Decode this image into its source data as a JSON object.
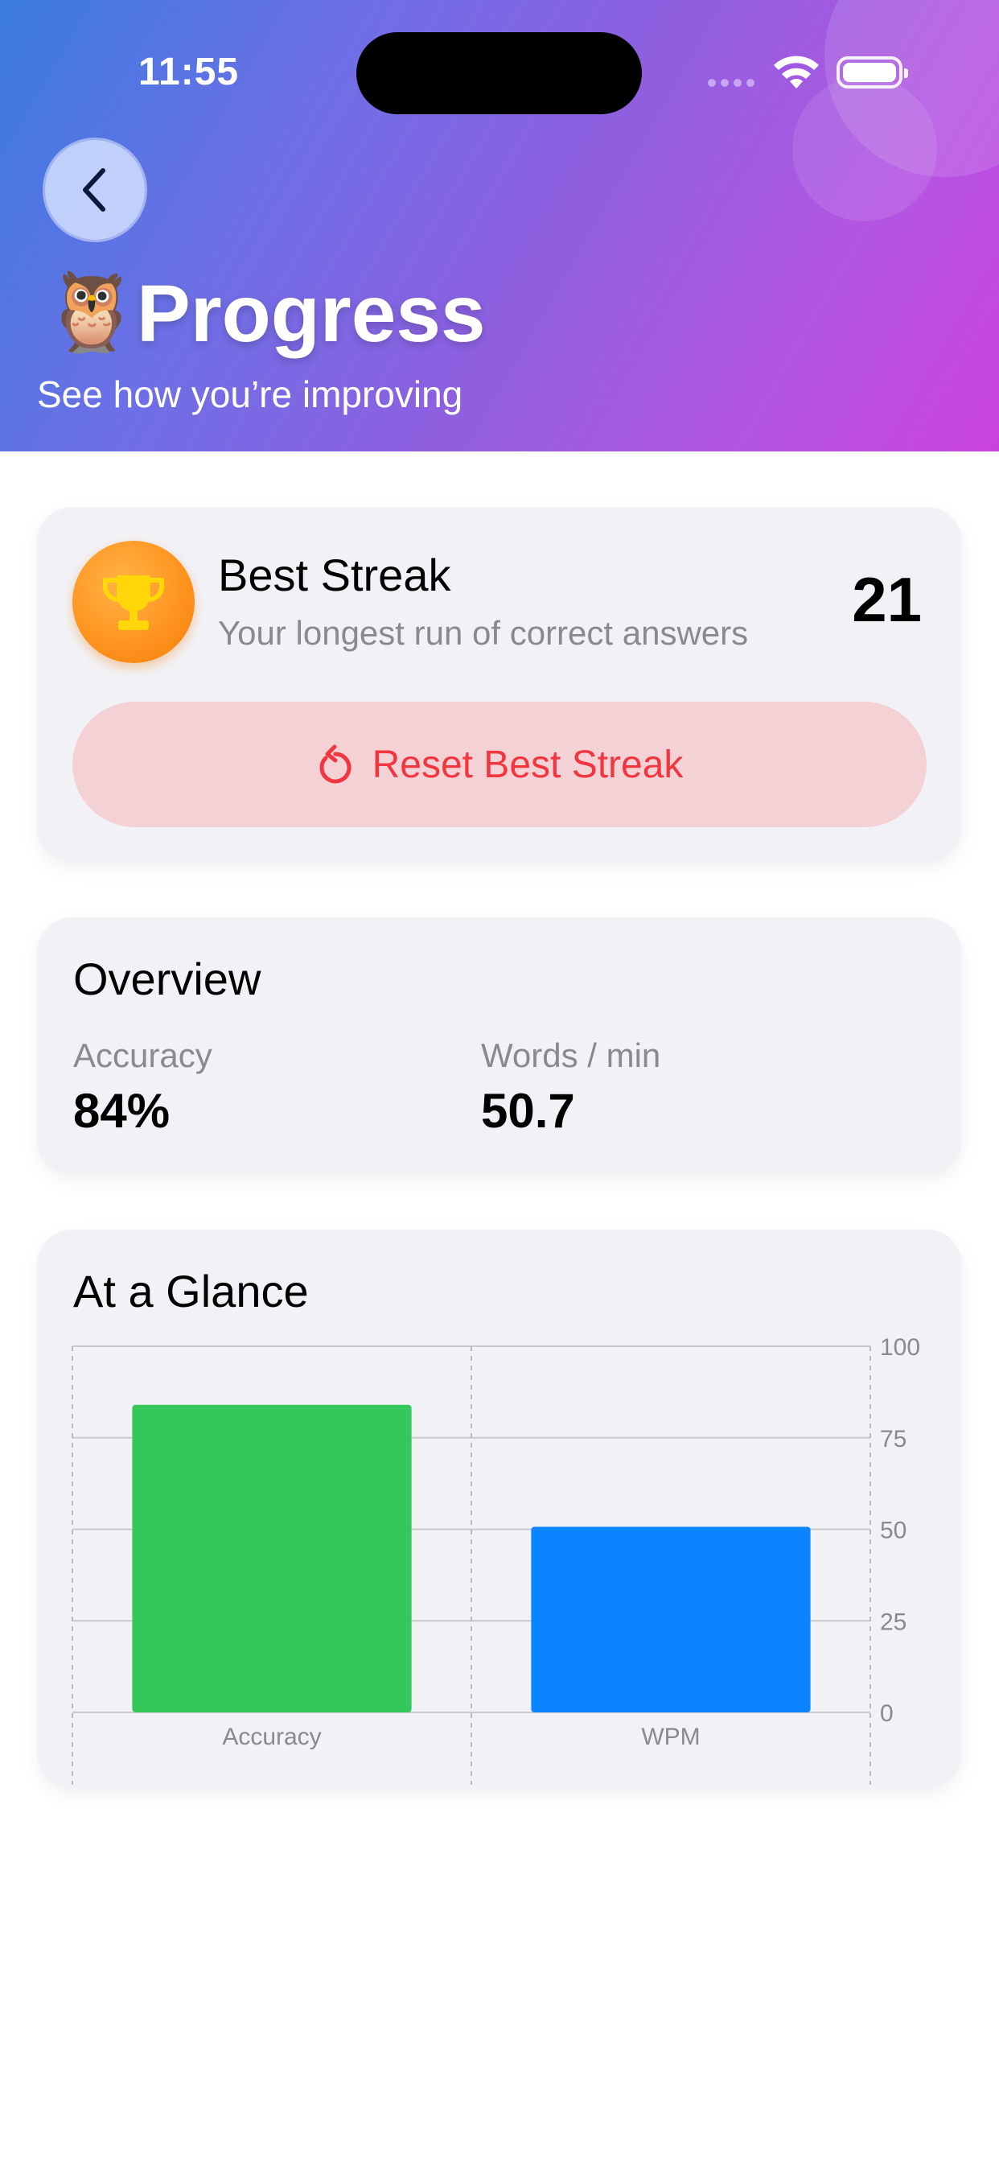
{
  "status_bar": {
    "time": "11:55"
  },
  "header": {
    "title": "Progress",
    "subtitle": "See how you’re improving",
    "emoji": "🦉"
  },
  "best_streak": {
    "title": "Best Streak",
    "description": "Your longest run of correct answers",
    "value": "21",
    "reset_label": "Reset Best Streak"
  },
  "overview": {
    "title": "Overview",
    "stats": [
      {
        "label": "Accuracy",
        "value": "84%"
      },
      {
        "label": "Words / min",
        "value": "50.7"
      }
    ]
  },
  "glance": {
    "title": "At a Glance"
  },
  "chart_data": {
    "type": "bar",
    "categories": [
      "Accuracy",
      "WPM"
    ],
    "values": [
      84,
      50.7
    ],
    "colors": [
      "#34c759",
      "#0a84ff"
    ],
    "ylim": [
      0,
      100
    ],
    "yticks": [
      "0",
      "25",
      "50",
      "75",
      "100"
    ],
    "ytick_values": [
      0,
      25,
      50,
      75,
      100
    ],
    "y_axis_side": "right",
    "grid": true
  },
  "colors": {
    "header_gradient_start": "#3a7be0",
    "header_gradient_end": "#c942e0",
    "reset_text": "#f2363f",
    "reset_background": "#f4d1d5",
    "trophy_badge": "#ff9520"
  }
}
